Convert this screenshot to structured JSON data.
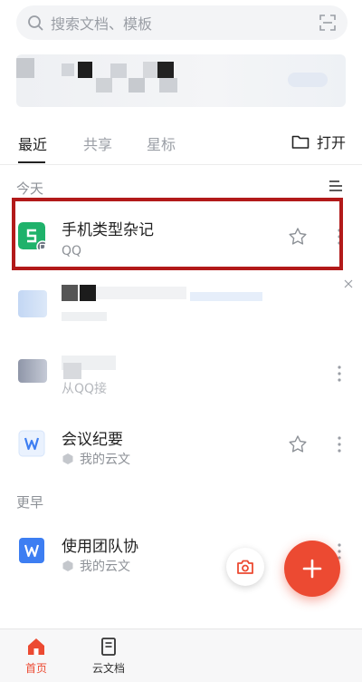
{
  "search": {
    "placeholder": "搜索文档、模板"
  },
  "tabs": {
    "items": [
      {
        "label": "最近"
      },
      {
        "label": "共享"
      },
      {
        "label": "星标"
      }
    ],
    "open_label": "打开"
  },
  "sections": {
    "today": "今天",
    "earlier": "更早"
  },
  "files": [
    {
      "title": "手机类型杂记",
      "subtitle": "QQ",
      "icon": "sheet-icon",
      "highlighted": true
    },
    {
      "title": "",
      "subtitle": "",
      "icon": "blurred-thumbnail"
    },
    {
      "title": "",
      "subtitle": "从QQ接",
      "icon": "blurred-thumbnail"
    },
    {
      "title": "会议纪要",
      "subtitle": "我的云文",
      "icon": "word-doc-icon"
    },
    {
      "title": "使用团队协",
      "subtitle": "我的云文",
      "icon": "word-doc-icon"
    }
  ],
  "bottom_nav": [
    {
      "label": "首页",
      "icon": "home-icon",
      "active": true
    },
    {
      "label": "云文档",
      "icon": "document-icon",
      "active": false
    }
  ],
  "colors": {
    "accent": "#ec4a32",
    "highlight_border": "#b21a1a",
    "sheet_green": "#1fb26b",
    "doc_blue": "#3d7ef2"
  }
}
